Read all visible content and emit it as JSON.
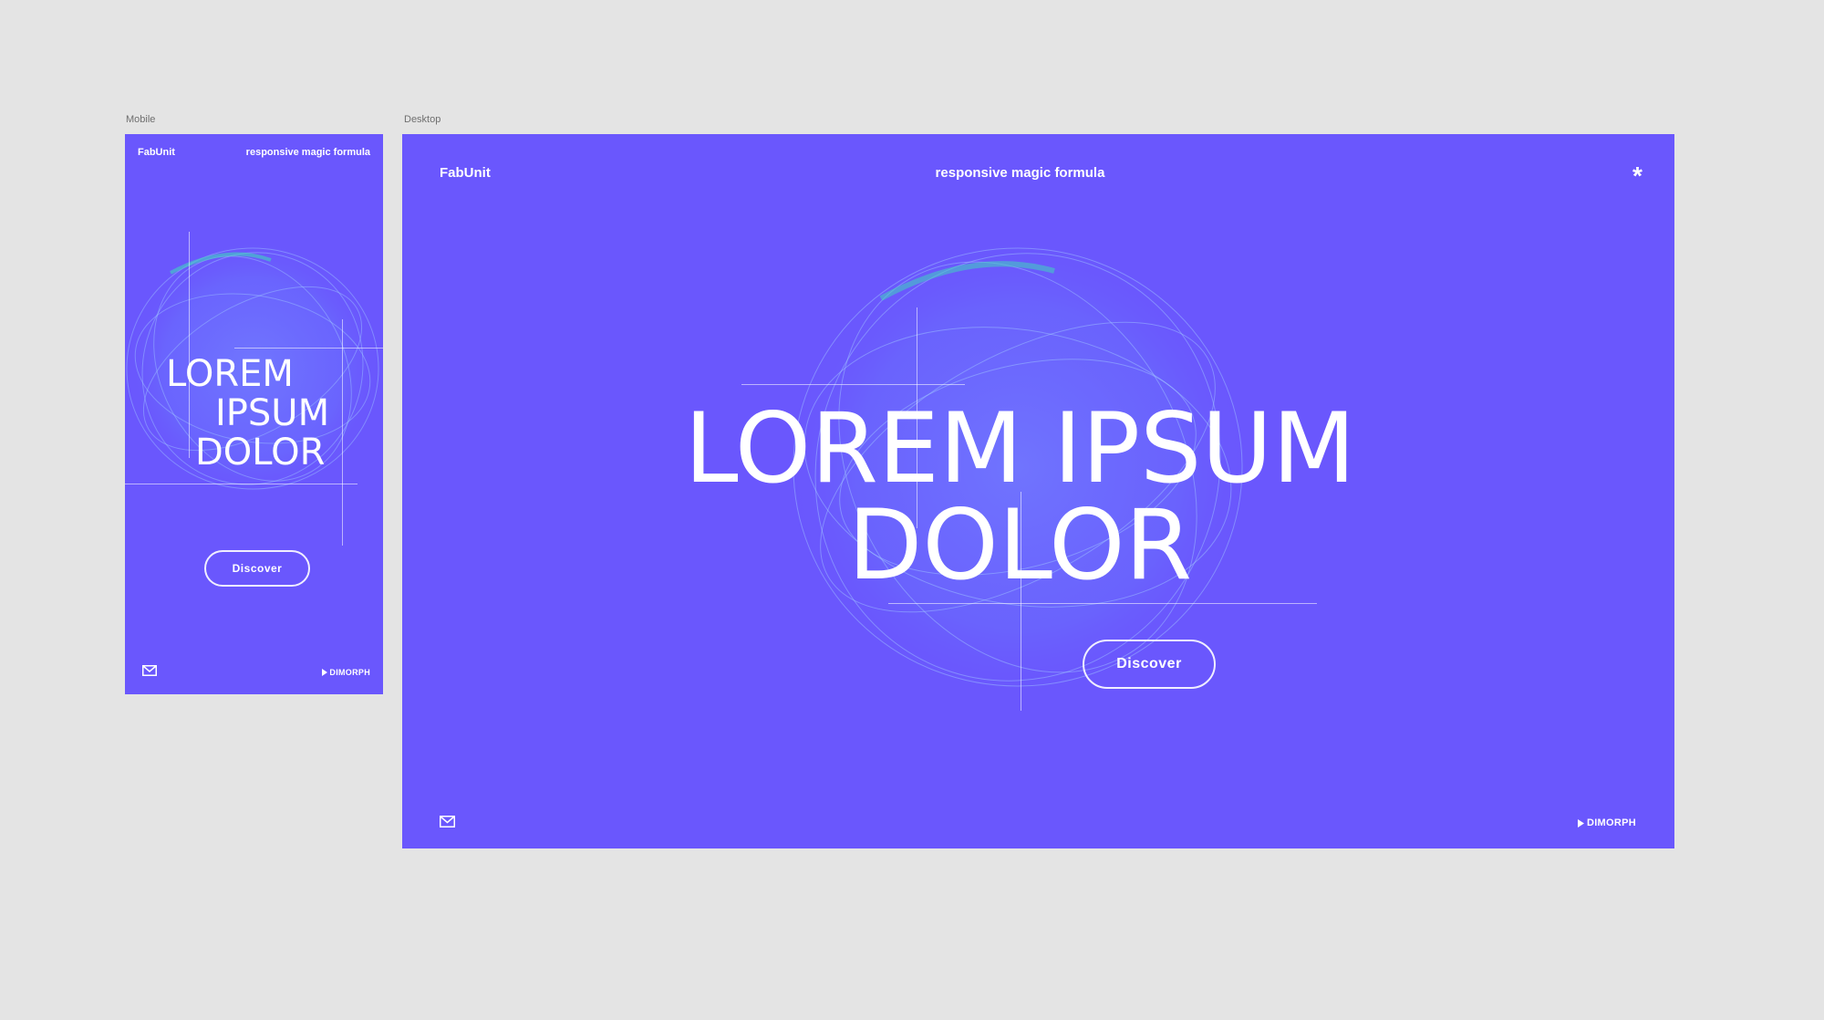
{
  "canvas": {
    "mobile_label": "Mobile",
    "desktop_label": "Desktop"
  },
  "mobile": {
    "brand": "FabUnit",
    "tagline": "responsive magic formula",
    "hero_line1": "LOREM",
    "hero_line2": "IPSUM",
    "hero_line3": "DOLOR",
    "cta_label": "Discover",
    "footer_logo": "DIMORPH"
  },
  "desktop": {
    "brand": "FabUnit",
    "tagline": "responsive magic formula",
    "menu_glyph": "*",
    "hero_line1": "LOREM IPSUM",
    "hero_line2": "DOLOR",
    "cta_label": "Discover",
    "footer_logo": "DIMORPH"
  },
  "colors": {
    "canvas_bg": "#e4e4e4",
    "frame_bg": "#6a57fd",
    "text": "#ffffff",
    "sphere_accent": "#3fd2c0"
  },
  "icons": [
    "mail-icon",
    "asterisk-icon",
    "dimorph-arrow-icon"
  ]
}
